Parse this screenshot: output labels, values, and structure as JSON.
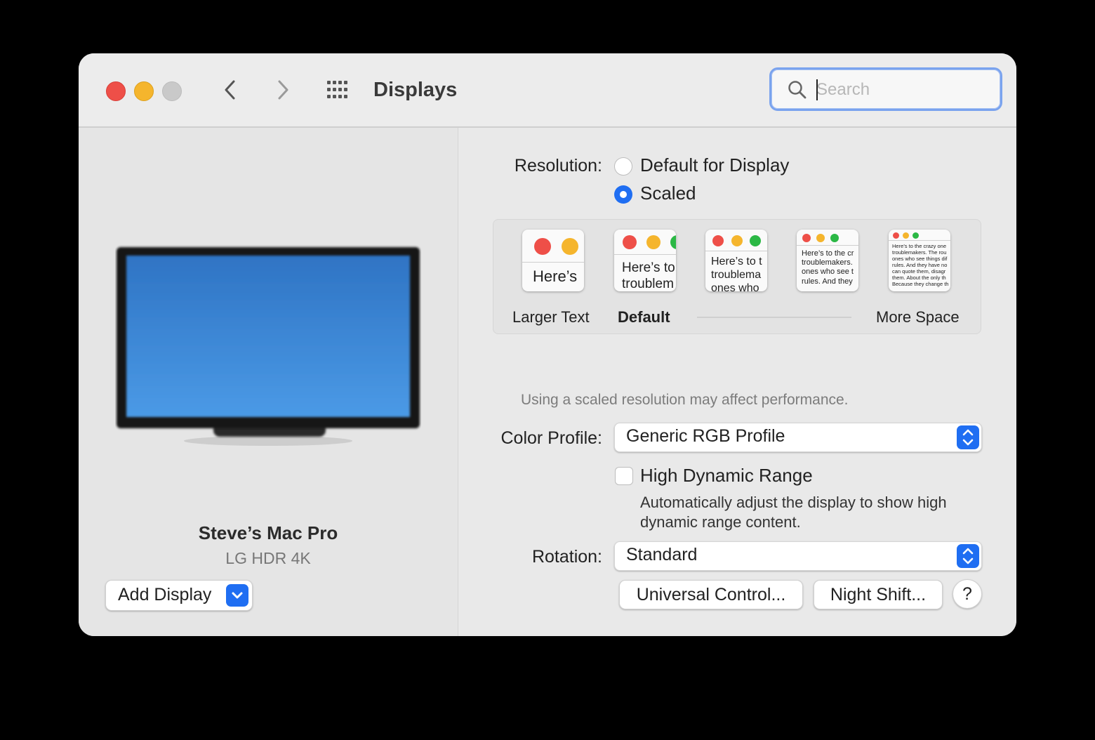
{
  "window": {
    "title": "Displays",
    "search": {
      "placeholder": "Search",
      "value": ""
    }
  },
  "icons": {
    "close": "close-light",
    "minimize": "minimize-light",
    "zoom": "zoom-light",
    "back": "chevron-left-icon",
    "forward": "chevron-right-icon",
    "grid": "grid-icon",
    "search": "search-icon"
  },
  "display": {
    "name": "Steve’s Mac Pro",
    "model": "LG HDR 4K",
    "add_button": "Add Display",
    "screen_color": "#3f8ee0"
  },
  "resolution": {
    "label": "Resolution:",
    "options": [
      "Default for Display",
      "Scaled"
    ],
    "selected": "Scaled",
    "scale_options": {
      "left_label": "Larger Text",
      "default_label": "Default",
      "right_label": "More Space",
      "thumb1": "Here’s",
      "thumb2": "Here’s to\ntroublem",
      "thumb3": "Here’s to t\ntroublema\nones who",
      "thumb4": "Here’s to the cr\ntroublemakers.\nones who see t\nrules. And they",
      "thumb5": "Here’s to the crazy one\ntroublemakers. The rou\nones who see things dif\nrules. And they have no\ncan quote them, disagr\nthem. About the only th\nBecause they change th"
    },
    "hint": "Using a scaled resolution may affect performance."
  },
  "color_profile": {
    "label": "Color Profile:",
    "value": "Generic RGB Profile"
  },
  "hdr": {
    "label": "High Dynamic Range",
    "checked": false,
    "description": "Automatically adjust the display to show high dynamic range content."
  },
  "rotation": {
    "label": "Rotation:",
    "value": "Standard"
  },
  "buttons": {
    "universal_control": "Universal Control...",
    "night_shift": "Night Shift...",
    "help": "?"
  },
  "colors": {
    "accent": "#1f6ef2",
    "close": "#ee4f48",
    "minimize": "#f5b52d"
  }
}
